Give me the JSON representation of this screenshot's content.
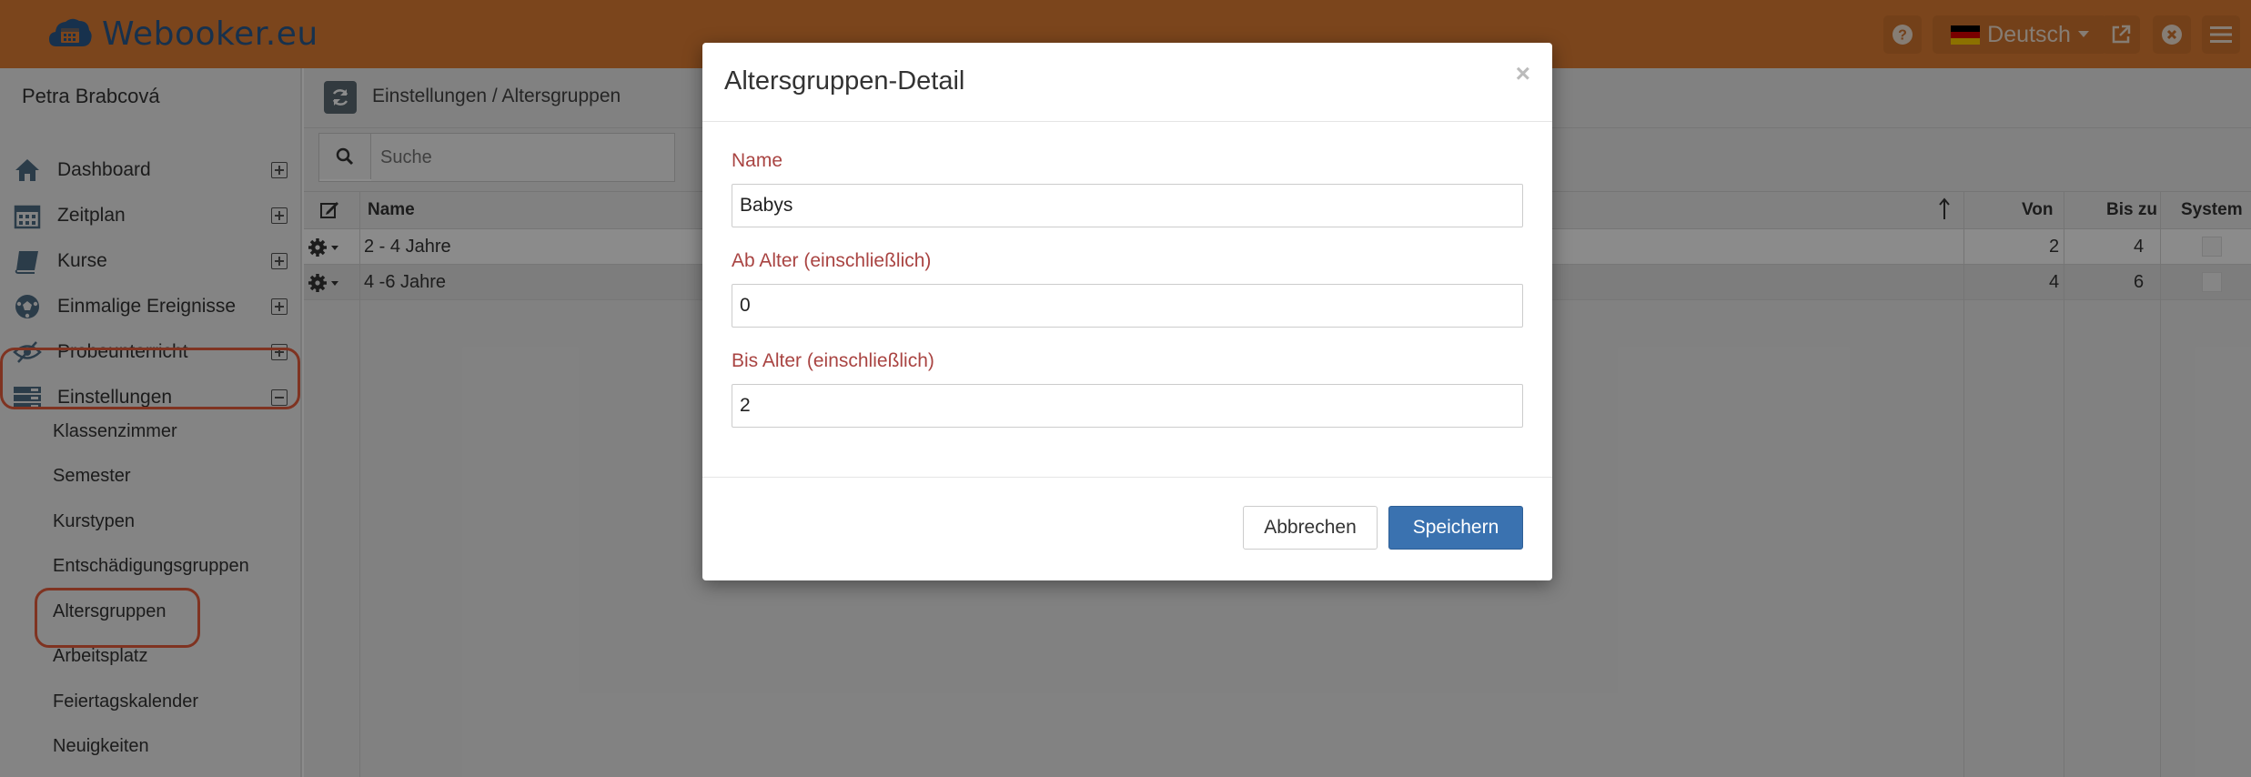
{
  "header": {
    "brand": "Webooker.eu",
    "language": "Deutsch",
    "accent_color": "#e07e33",
    "brand_color": "#2b5a8c",
    "icons": [
      "calendar-cloud-icon",
      "help-icon",
      "german-flag-icon",
      "caret-down-icon",
      "external-link-icon",
      "close-circle-icon",
      "hamburger-menu-icon"
    ]
  },
  "sidebar": {
    "user": "Petra Brabcová",
    "items": [
      {
        "label": "Dashboard",
        "icon": "home-icon"
      },
      {
        "label": "Zeitplan",
        "icon": "calendar-icon"
      },
      {
        "label": "Kurse",
        "icon": "book-icon"
      },
      {
        "label": "Einmalige Ereignisse",
        "icon": "soccer-ball-icon"
      },
      {
        "label": "Probeunterricht",
        "icon": "eye-slash-icon"
      },
      {
        "label": "Einstellungen",
        "icon": "settings-panel-icon"
      }
    ],
    "subitems": [
      "Klassenzimmer",
      "Semester",
      "Kurstypen",
      "Entschädigungsgruppen",
      "Altersgruppen",
      "Arbeitsplatz",
      "Feiertagskalender",
      "Neuigkeiten"
    ],
    "highlight_color": "#e85d3c"
  },
  "main": {
    "breadcrumb": "Einstellungen / Altersgruppen",
    "search_placeholder": "Suche",
    "columns": {
      "name": "Name",
      "von": "Von",
      "bis": "Bis zu",
      "system": "System"
    },
    "rows": [
      {
        "name": "2 - 4 Jahre",
        "von": "2",
        "bis": "4"
      },
      {
        "name": "4 -6 Jahre",
        "von": "4",
        "bis": "6"
      }
    ]
  },
  "modal": {
    "title": "Altersgruppen-Detail",
    "close": "×",
    "fields": [
      {
        "label": "Name",
        "value": "Babys"
      },
      {
        "label": "Ab Alter (einschließlich)",
        "value": "0"
      },
      {
        "label": "Bis Alter (einschließlich)",
        "value": "2"
      }
    ],
    "cancel_label": "Abbrechen",
    "save_label": "Speichern",
    "label_color": "#a94442",
    "primary_color": "#3a72b0"
  }
}
